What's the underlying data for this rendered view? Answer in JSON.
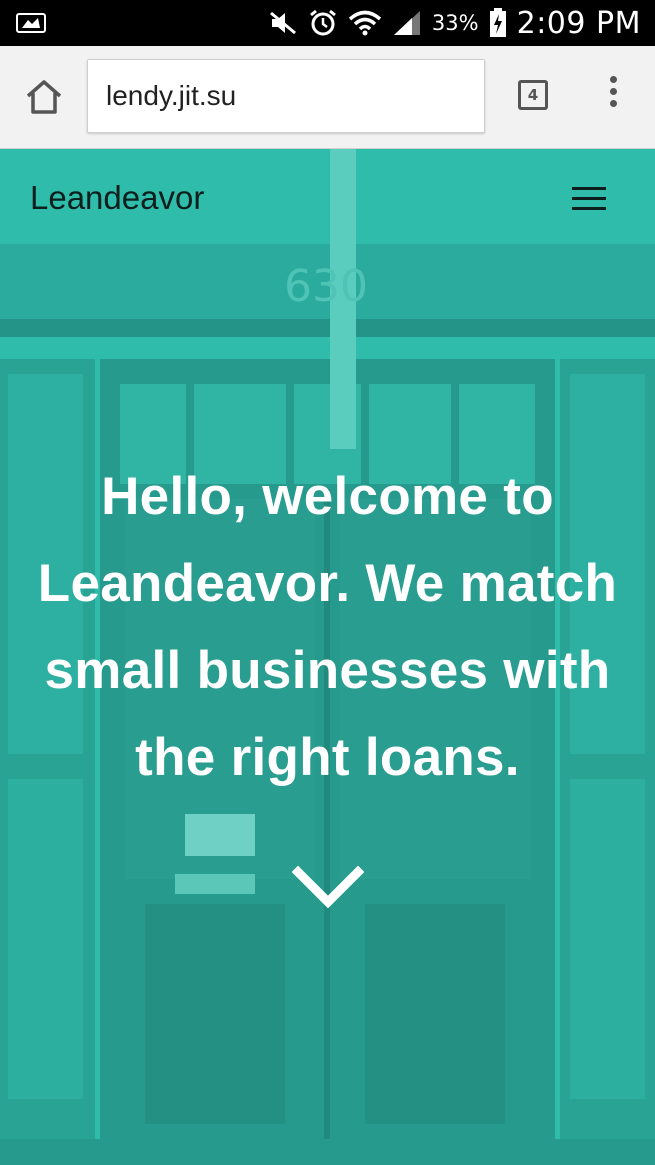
{
  "status_bar": {
    "battery_percent": "33%",
    "time": "2:09 PM",
    "icons": [
      "mlb-logo-icon",
      "mute-icon",
      "alarm-icon",
      "wifi-icon",
      "signal-icon",
      "battery-charging-icon"
    ]
  },
  "browser": {
    "url": "lendy.jit.su",
    "tab_count": "4",
    "icons": [
      "home-icon",
      "tabs-icon",
      "overflow-menu-icon"
    ]
  },
  "site": {
    "brand": "Leandeavor",
    "headline": "Hello, welcome to Leandeavor. We match small businesses with the right loans.",
    "building_number": "630",
    "icons": [
      "hamburger-menu-icon",
      "chevron-down-icon"
    ],
    "colors": {
      "hero_tint": "#2fb8a8",
      "headline": "#ffffff",
      "nav_text": "#0d1f1d"
    }
  }
}
